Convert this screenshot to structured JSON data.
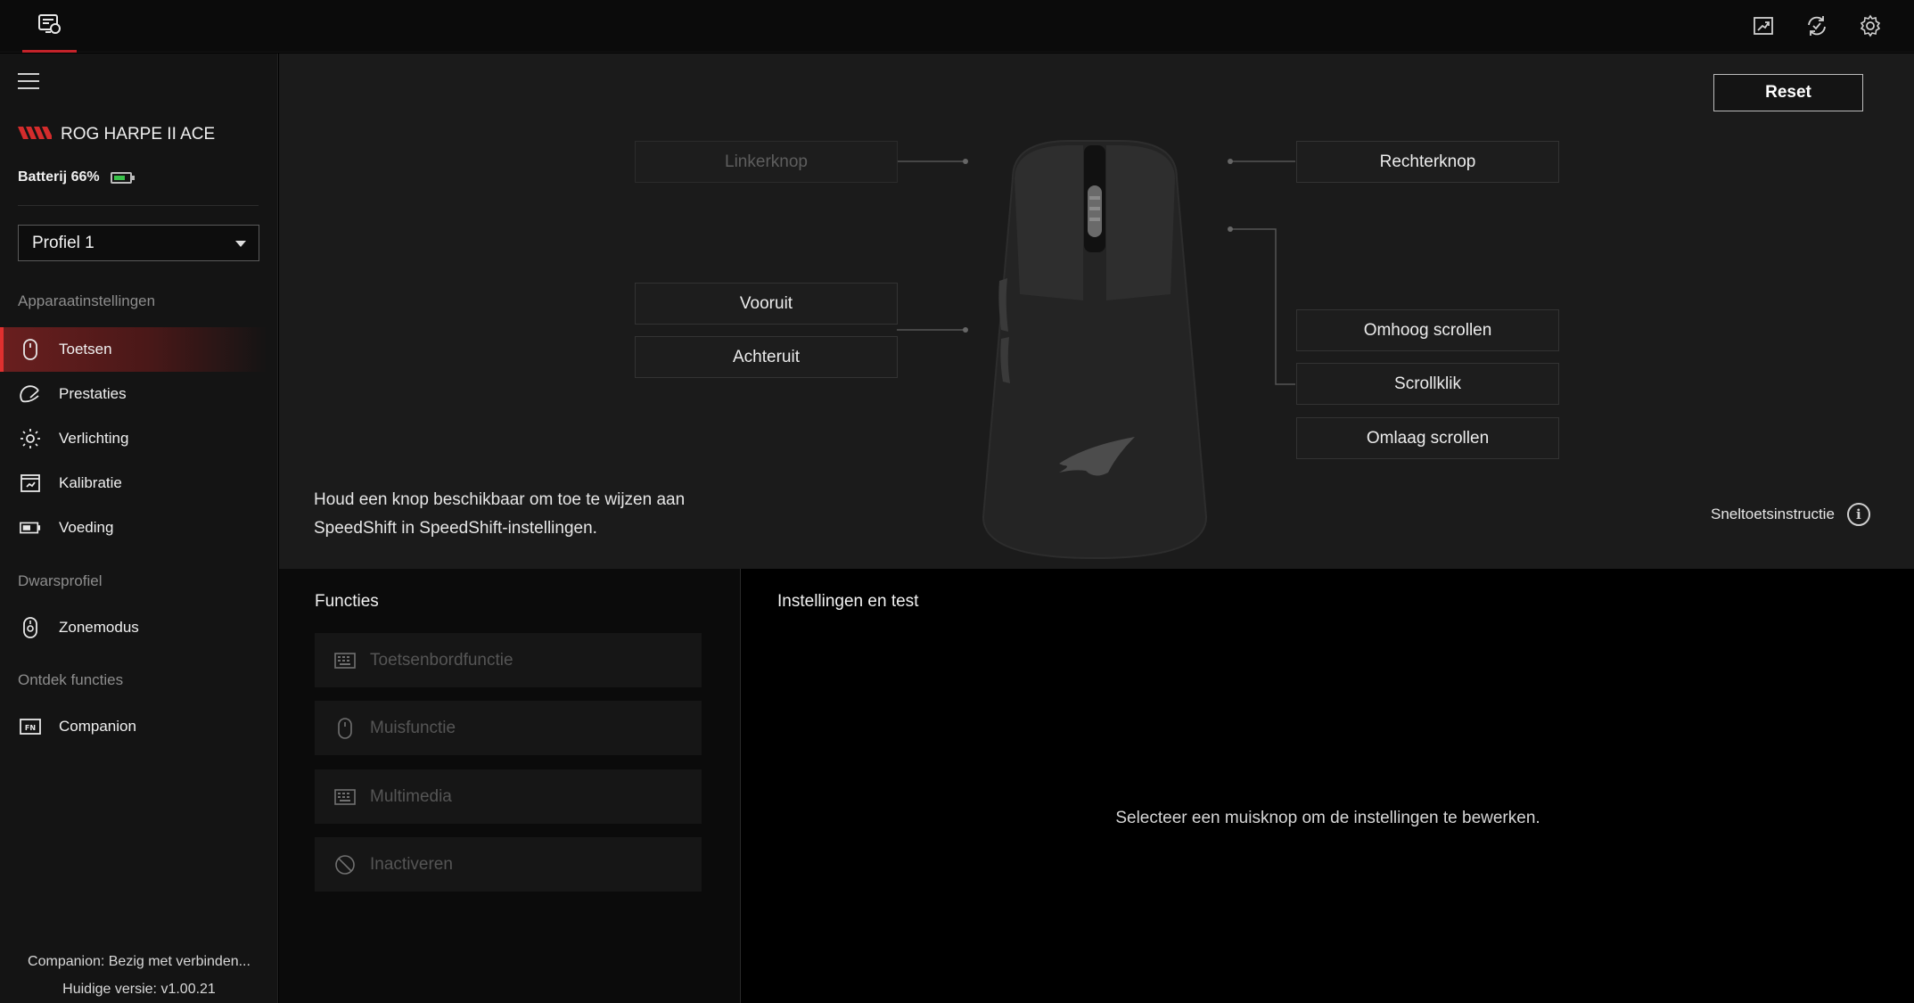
{
  "topbar": {
    "app_icon": "device-icon",
    "actions": [
      "image-export-icon",
      "sync-icon",
      "gear-icon"
    ]
  },
  "sidebar": {
    "menu_icon": "hamburger-icon",
    "device_logo": "rog-logo",
    "device_name": "ROG HARPE II ACE",
    "battery_label": "Batterij 66%",
    "battery_level": 0.66,
    "profile_selected": "Profiel 1",
    "sections": {
      "device_settings": "Apparaatinstellingen",
      "cross_profile": "Dwarsprofiel",
      "discover": "Ontdek functies"
    },
    "items": [
      {
        "label": "Toetsen",
        "icon": "mouse-icon",
        "active": true
      },
      {
        "label": "Prestaties",
        "icon": "performance-icon",
        "active": false
      },
      {
        "label": "Verlichting",
        "icon": "lighting-icon",
        "active": false
      },
      {
        "label": "Kalibratie",
        "icon": "calibration-icon",
        "active": false
      },
      {
        "label": "Voeding",
        "icon": "battery-icon",
        "active": false
      },
      {
        "label": "Zonemodus",
        "icon": "zone-icon",
        "active": false
      },
      {
        "label": "Companion",
        "icon": "fn-icon",
        "active": false
      }
    ],
    "footer_status": "Companion: Bezig met verbinden...",
    "footer_version": "Huidige versie: v1.00.21"
  },
  "main": {
    "reset_label": "Reset",
    "buttons": {
      "left_click": "Linkerknop",
      "right_click": "Rechterknop",
      "forward": "Vooruit",
      "back": "Achteruit",
      "scroll_up": "Omhoog scrollen",
      "scroll_click": "Scrollklik",
      "scroll_down": "Omlaag scrollen"
    },
    "hint": "Houd een knop beschikbaar om toe te wijzen aan SpeedShift in SpeedShift-instellingen.",
    "shortcut_label": "Sneltoetsinstructie"
  },
  "functions": {
    "title": "Functies",
    "items": [
      {
        "label": "Toetsenbordfunctie",
        "icon": "keyboard-icon"
      },
      {
        "label": "Muisfunctie",
        "icon": "mouse-icon"
      },
      {
        "label": "Multimedia",
        "icon": "keyboard-icon"
      },
      {
        "label": "Inactiveren",
        "icon": "disable-icon"
      }
    ]
  },
  "settings": {
    "title": "Instellingen en test",
    "placeholder": "Selecteer een muisknop om de instellingen te bewerken."
  },
  "colors": {
    "accent": "#e0302f",
    "battery_green": "#39c24a"
  }
}
